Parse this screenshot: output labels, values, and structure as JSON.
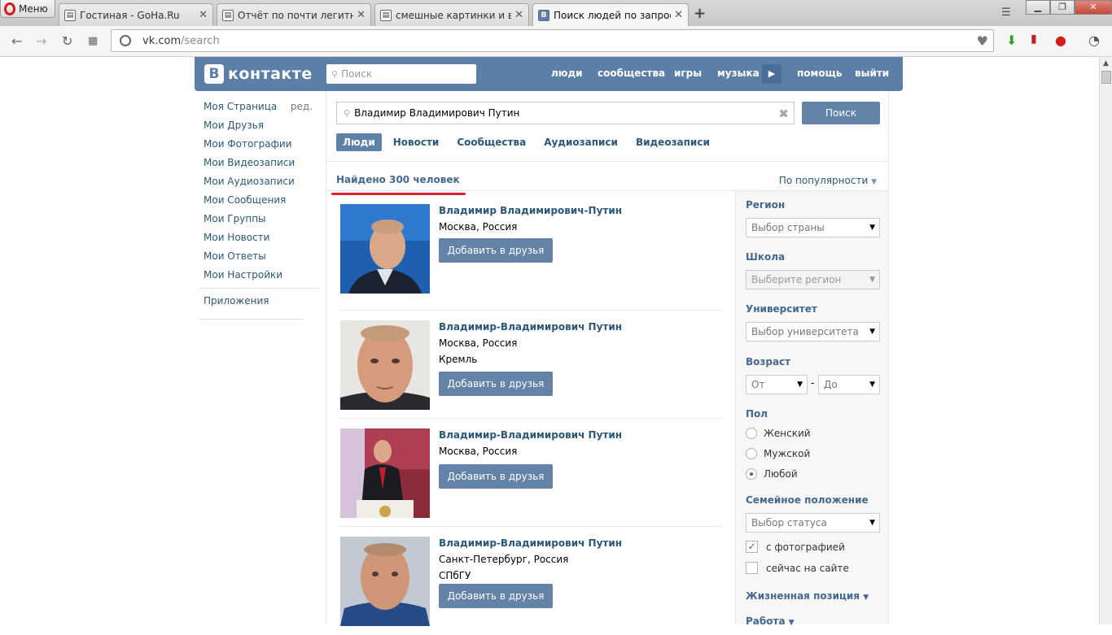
{
  "browser": {
    "menu_label": "Меню",
    "tabs": [
      {
        "title": "Гостиная - GoHa.Ru",
        "close": "✕"
      },
      {
        "title": "Отчёт по почти легитно п",
        "close": "✕"
      },
      {
        "title": "смешные картинки и вид",
        "close": "✕"
      },
      {
        "title": "Поиск людей по запросу",
        "close": "✕"
      }
    ],
    "new_tab": "+",
    "url_host": "vk.com",
    "url_path": "/search"
  },
  "vk": {
    "header": {
      "logo_letter": "В",
      "logo_word": "контакте",
      "search_placeholder": "Поиск",
      "nav": [
        "люди",
        "сообщества",
        "игры",
        "музыка",
        "помощь",
        "выйти"
      ]
    },
    "left_menu": {
      "items": [
        "Моя Страница",
        "Мои Друзья",
        "Мои Фотографии",
        "Мои Видеозаписи",
        "Мои Аудиозаписи",
        "Мои Сообщения",
        "Мои Группы",
        "Мои Новости",
        "Мои Ответы",
        "Мои Настройки"
      ],
      "edit_label": "ред.",
      "apps": "Приложения"
    },
    "search": {
      "query": "Владимир Владимирович Путин",
      "button": "Поиск",
      "tabs": [
        "Люди",
        "Новости",
        "Сообщества",
        "Аудиозаписи",
        "Видеозаписи"
      ],
      "found": "Найдено 300 человек",
      "sort": "По популярности"
    },
    "results": [
      {
        "name": "Владимир Владимирович-Путин",
        "lines": [
          "Москва, Россия"
        ],
        "button": "Добавить в друзья"
      },
      {
        "name": "Владимир-Владимирович Путин",
        "lines": [
          "Москва, Россия",
          "Кремль"
        ],
        "button": "Добавить в друзья"
      },
      {
        "name": "Владимир-Владимирович Путин",
        "lines": [
          "Москва, Россия"
        ],
        "button": "Добавить в друзья"
      },
      {
        "name": "Владимир-Владимирович Путин",
        "lines": [
          "Санкт-Петербург, Россия",
          "СПбГУ"
        ],
        "button": "Добавить в друзья"
      }
    ],
    "filters": {
      "region_label": "Регион",
      "region_value": "Выбор страны",
      "school_label": "Школа",
      "school_value": "Выберите регион",
      "university_label": "Университет",
      "university_value": "Выбор университета",
      "age_label": "Возраст",
      "age_from": "От",
      "age_dash": "-",
      "age_to": "До",
      "sex_label": "Пол",
      "sex_options": [
        "Женский",
        "Мужской",
        "Любой"
      ],
      "sex_selected": "Любой",
      "marital_label": "Семейное положение",
      "marital_value": "Выбор статуса",
      "with_photo": "с фотографией",
      "with_photo_checked": true,
      "online_now": "сейчас на сайте",
      "online_now_checked": false,
      "life_position": "Жизненная позиция",
      "work": "Работа"
    }
  },
  "colors": {
    "vk_blue": "#5b7fa6",
    "link": "#2b587a",
    "button": "#6383a8",
    "annotation_red": "#e0202e"
  }
}
